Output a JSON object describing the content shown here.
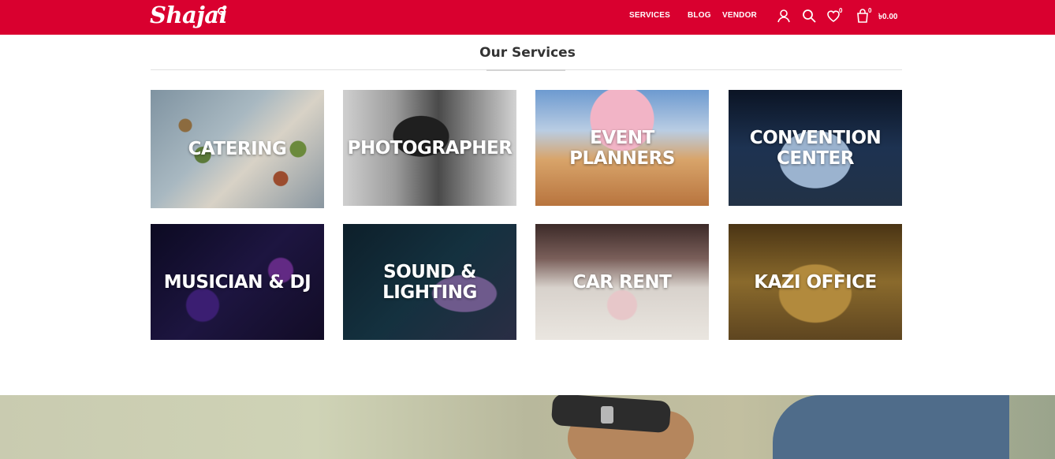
{
  "header": {
    "logo_text": "Shajai",
    "nav": {
      "services": "SERVICES",
      "blog": "BLOG",
      "vendor": "VENDOR"
    },
    "icons": {
      "account": "user-icon",
      "search": "search-icon",
      "wishlist": "heart-icon",
      "cart": "shopping-bag-icon"
    },
    "wishlist_count": "0",
    "cart_count": "0",
    "cart_total": "৳0.00",
    "brand_color": "#d9002f"
  },
  "services_section": {
    "title": "Our Services",
    "cards": [
      {
        "label": "CATERING"
      },
      {
        "label": "PHOTOGRAPHER"
      },
      {
        "label": "EVENT PLANNERS"
      },
      {
        "label": "CONVENTION CENTER"
      },
      {
        "label": "MUSICIAN & DJ"
      },
      {
        "label": "SOUND & LIGHTING"
      },
      {
        "label": "CAR RENT"
      },
      {
        "label": "KAZI OFFICE"
      }
    ]
  }
}
